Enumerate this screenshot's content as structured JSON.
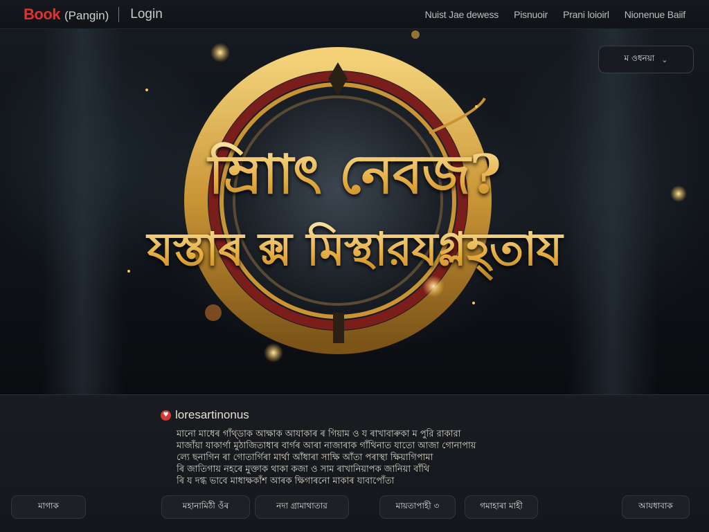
{
  "header": {
    "brand": "Book",
    "brand_sub": "(Pangin)",
    "login": "Login",
    "nav": [
      "Nuist Jae dewess",
      "Pisnuoir",
      "Prani loioirl",
      "Nionenue Baiif"
    ]
  },
  "hero": {
    "title_line_1": "ম্রিাাৎ নেবজ?",
    "title_line_2": "যস্তাৰ ক্স মিস্থারযগ্লহ্তায",
    "badge_label": "ম ওধনয়া",
    "badge_icon": "chevron-down-icon"
  },
  "info": {
    "heading": "loresartinonus",
    "lines": [
      "মানো মাধেৰ গাঁথ্ডাক আক্ষাক আযাকাৰ ৰ গিয়াম ও য ৰাখাবাৰুকা ম পুরি রাকারা",
      "মাজাঁয়া যাকাৰ্গা মুঠাজিতাধাৰ বাৰ্গৰ আৰা নাজাৰাক গাঁথিনাত যাতো আজা গোনাপায়",
      "ল্যে ছনাগিন ৰা গোতাৰ্গিৰা মাৰ্থা আঁধাৰা সাক্ষি আঁতা পৰাস্থা ক্ষিয়াগিপামা",
      "ৰি জাতিগায় নহৰে মুক্তাক থাকা কজা ও সাম ৰাখানিয়াপক জানিয়া বাঁথি",
      "ৰি য দগ্ধ ভাবে মাধাক্ষকাঁশ আৰক ক্ষিগাৰনো মাকাৰ যাবাপোঁতা"
    ]
  },
  "buttons": [
    "মাগাক",
    "মহানামিঠী ওঁৰ",
    "নদা গ্ৰামাথাতার",
    "মায়তাপাহী ৩",
    "গমাহাৰা মাহী",
    "আযধাবাক"
  ],
  "colors": {
    "brand": "#e1322f",
    "gold": "#e3a93d",
    "accent_red": "#d73a34"
  }
}
